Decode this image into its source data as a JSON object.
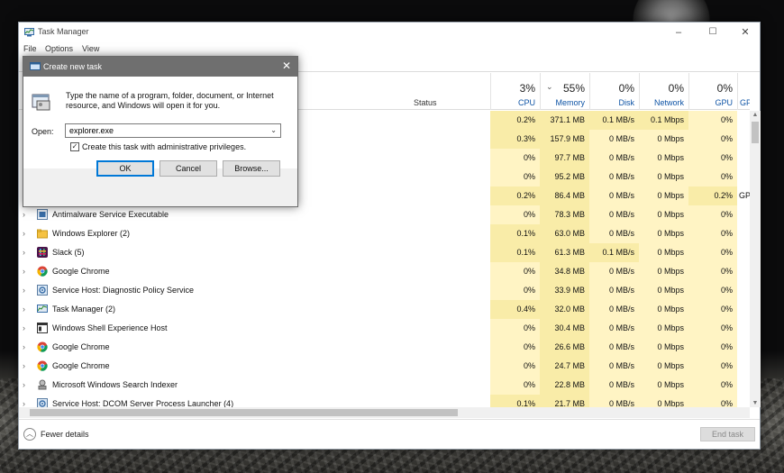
{
  "window": {
    "title": "Task Manager",
    "menu": [
      "File",
      "Options",
      "View"
    ],
    "controls": {
      "minimize": "–",
      "maximize": "☐",
      "close": "✕"
    }
  },
  "columns": {
    "status": "Status",
    "cpu": {
      "pct": "3%",
      "label": "CPU"
    },
    "memory": {
      "pct": "55%",
      "label": "Memory",
      "sort": "⌄"
    },
    "disk": {
      "pct": "0%",
      "label": "Disk"
    },
    "network": {
      "pct": "0%",
      "label": "Network"
    },
    "gpu": {
      "pct": "0%",
      "label": "GPU"
    },
    "gpu_engine": {
      "label": "GPU e"
    }
  },
  "rows": [
    {
      "name": "",
      "cpu": "0.2%",
      "memory": "371.1 MB",
      "disk": "0.1 MB/s",
      "network": "0.1 Mbps",
      "gpu": "0%",
      "gpu_engine": ""
    },
    {
      "name": "",
      "cpu": "0.3%",
      "memory": "157.9 MB",
      "disk": "0 MB/s",
      "network": "0 Mbps",
      "gpu": "0%",
      "gpu_engine": ""
    },
    {
      "name": "",
      "cpu": "0%",
      "memory": "97.7 MB",
      "disk": "0 MB/s",
      "network": "0 Mbps",
      "gpu": "0%",
      "gpu_engine": ""
    },
    {
      "name": "",
      "cpu": "0%",
      "memory": "95.2 MB",
      "disk": "0 MB/s",
      "network": "0 Mbps",
      "gpu": "0%",
      "gpu_engine": ""
    },
    {
      "name": "",
      "cpu": "0.2%",
      "memory": "86.4 MB",
      "disk": "0 MB/s",
      "network": "0 Mbps",
      "gpu": "0.2%",
      "gpu_engine": "GP"
    },
    {
      "name": "Antimalware Service Executable",
      "icon": "antimalware-icon",
      "cpu": "0%",
      "memory": "78.3 MB",
      "disk": "0 MB/s",
      "network": "0 Mbps",
      "gpu": "0%",
      "gpu_engine": ""
    },
    {
      "name": "Windows Explorer (2)",
      "icon": "folder-icon",
      "cpu": "0.1%",
      "memory": "63.0 MB",
      "disk": "0 MB/s",
      "network": "0 Mbps",
      "gpu": "0%",
      "gpu_engine": ""
    },
    {
      "name": "Slack (5)",
      "icon": "slack-icon",
      "cpu": "0.1%",
      "memory": "61.3 MB",
      "disk": "0.1 MB/s",
      "network": "0 Mbps",
      "gpu": "0%",
      "gpu_engine": ""
    },
    {
      "name": "Google Chrome",
      "icon": "chrome-icon",
      "cpu": "0%",
      "memory": "34.8 MB",
      "disk": "0 MB/s",
      "network": "0 Mbps",
      "gpu": "0%",
      "gpu_engine": ""
    },
    {
      "name": "Service Host: Diagnostic Policy Service",
      "icon": "gear-icon",
      "cpu": "0%",
      "memory": "33.9 MB",
      "disk": "0 MB/s",
      "network": "0 Mbps",
      "gpu": "0%",
      "gpu_engine": ""
    },
    {
      "name": "Task Manager (2)",
      "icon": "task-manager-icon",
      "cpu": "0.4%",
      "memory": "32.0 MB",
      "disk": "0 MB/s",
      "network": "0 Mbps",
      "gpu": "0%",
      "gpu_engine": ""
    },
    {
      "name": "Windows Shell Experience Host",
      "icon": "window-icon",
      "cpu": "0%",
      "memory": "30.4 MB",
      "disk": "0 MB/s",
      "network": "0 Mbps",
      "gpu": "0%",
      "gpu_engine": ""
    },
    {
      "name": "Google Chrome",
      "icon": "chrome-icon",
      "cpu": "0%",
      "memory": "26.6 MB",
      "disk": "0 MB/s",
      "network": "0 Mbps",
      "gpu": "0%",
      "gpu_engine": ""
    },
    {
      "name": "Google Chrome",
      "icon": "chrome-icon",
      "cpu": "0%",
      "memory": "24.7 MB",
      "disk": "0 MB/s",
      "network": "0 Mbps",
      "gpu": "0%",
      "gpu_engine": ""
    },
    {
      "name": "Microsoft Windows Search Indexer",
      "icon": "search-indexer-icon",
      "cpu": "0%",
      "memory": "22.8 MB",
      "disk": "0 MB/s",
      "network": "0 Mbps",
      "gpu": "0%",
      "gpu_engine": ""
    },
    {
      "name": "Service Host: DCOM Server Process Launcher (4)",
      "icon": "gear-icon",
      "cpu": "0.1%",
      "memory": "21.7 MB",
      "disk": "0 MB/s",
      "network": "0 Mbps",
      "gpu": "0%",
      "gpu_engine": ""
    }
  ],
  "footer": {
    "fewer_details": "Fewer details",
    "end_task": "End task"
  },
  "dialog": {
    "title": "Create new task",
    "description": "Type the name of a program, folder, document, or Internet resource, and Windows will open it for you.",
    "open_label": "Open:",
    "open_value": "explorer.exe",
    "admin_checkbox_label": "Create this task with administrative privileges.",
    "admin_checked": true,
    "buttons": {
      "ok": "OK",
      "cancel": "Cancel",
      "browse": "Browse..."
    }
  },
  "colors": {
    "heat": "#fff4c4",
    "heat_dark": "#f9eca8",
    "accent": "#0078d7",
    "header_label": "#0d53a5"
  }
}
